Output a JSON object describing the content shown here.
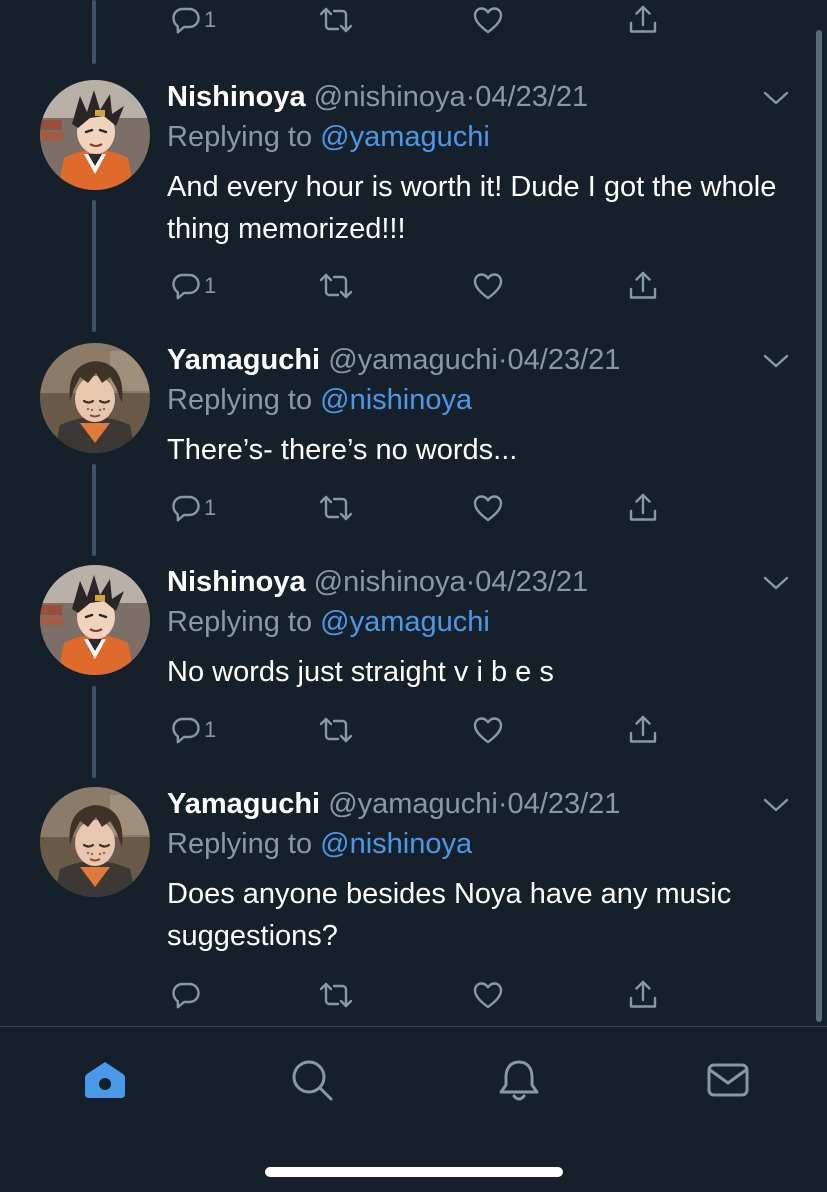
{
  "theme": {
    "background": "#15202b",
    "text": "#ffffff",
    "muted": "#8899a6",
    "accent": "#4a99e9",
    "thread_line": "#3d5466"
  },
  "top_actions": {
    "reply_count": "1"
  },
  "tweets": [
    {
      "name": "Nishinoya",
      "handle": "@nishinoya",
      "dot": "·",
      "date": "04/23/21",
      "replying_prefix": "Replying to",
      "replying_to": "@yamaguchi",
      "text": "And every hour is worth it! Dude I got the whole thing memorized!!!",
      "reply_count": "1",
      "avatar_icon": "nishinoya-avatar"
    },
    {
      "name": "Yamaguchi",
      "handle": "@yamaguchi",
      "dot": "·",
      "date": "04/23/21",
      "replying_prefix": "Replying to",
      "replying_to": "@nishinoya",
      "text": "There’s- there’s no words...",
      "reply_count": "1",
      "avatar_icon": "yamaguchi-avatar"
    },
    {
      "name": "Nishinoya",
      "handle": "@nishinoya",
      "dot": "·",
      "date": "04/23/21",
      "replying_prefix": "Replying to",
      "replying_to": "@yamaguchi",
      "text": "No words just straight v i b e s",
      "reply_count": "1",
      "avatar_icon": "nishinoya-avatar"
    },
    {
      "name": "Yamaguchi",
      "handle": "@yamaguchi",
      "dot": "·",
      "date": "04/23/21",
      "replying_prefix": "Replying to",
      "replying_to": "@nishinoya",
      "text": "Does anyone besides Noya have any music suggestions?",
      "reply_count": "",
      "avatar_icon": "yamaguchi-avatar"
    }
  ],
  "tabbar": {
    "items": [
      {
        "icon": "home-icon",
        "active": true
      },
      {
        "icon": "search-icon",
        "active": false
      },
      {
        "icon": "bell-icon",
        "active": false
      },
      {
        "icon": "mail-icon",
        "active": false
      }
    ]
  }
}
